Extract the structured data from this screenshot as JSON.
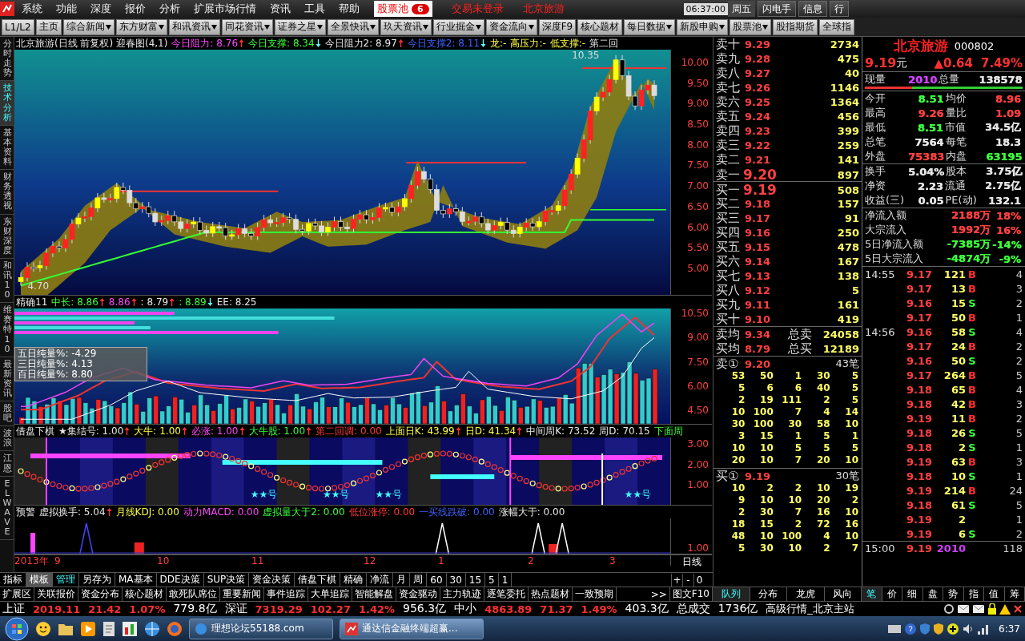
{
  "menu": {
    "items": [
      "系统",
      "功能",
      "深度",
      "报价",
      "分析",
      "扩展市场行情",
      "资讯",
      "工具",
      "帮助"
    ],
    "pool": {
      "label": "股票池",
      "count": "6"
    },
    "notices": [
      "交易未登录",
      "北京旅游"
    ],
    "time": "06:37:00",
    "weekday": "周五",
    "buttons": [
      "闪电手",
      "信息",
      "行"
    ]
  },
  "toolbar": [
    {
      "label": "L1/L2",
      "dropdown": false
    },
    {
      "label": "主页",
      "dropdown": false
    },
    {
      "label": "综合新闻",
      "dropdown": true
    },
    {
      "label": "东方财富",
      "dropdown": true
    },
    {
      "label": "和讯资讯",
      "dropdown": true
    },
    {
      "label": "同花资讯",
      "dropdown": true
    },
    {
      "label": "证券之星",
      "dropdown": true
    },
    {
      "label": "全景快讯",
      "dropdown": true
    },
    {
      "label": "玖天资讯",
      "dropdown": true
    },
    {
      "label": "行业掘金",
      "dropdown": true
    },
    {
      "label": "资金流向",
      "dropdown": true
    },
    {
      "label": "深度F9",
      "dropdown": false
    },
    {
      "label": "核心题材",
      "dropdown": false
    },
    {
      "label": "每日数据",
      "dropdown": true
    },
    {
      "label": "新股申购",
      "dropdown": true
    },
    {
      "label": "股票池",
      "dropdown": true
    },
    {
      "label": "股指期货",
      "dropdown": false
    },
    {
      "label": "全球指",
      "dropdown": false
    }
  ],
  "side_tabs": [
    {
      "label": "分时走势",
      "selected": false
    },
    {
      "label": "技术分析",
      "selected": true
    },
    {
      "label": "基本资料",
      "selected": false
    },
    {
      "label": "财务透视",
      "selected": false
    },
    {
      "label": "东财深度",
      "selected": false
    },
    {
      "label": "和讯10",
      "selected": false
    },
    {
      "label": "维赛特10",
      "selected": false
    },
    {
      "label": "最新资讯",
      "selected": false
    },
    {
      "label": "股吧",
      "selected": false
    },
    {
      "label": "波浪",
      "selected": false
    },
    {
      "label": "江恩",
      "selected": false
    },
    {
      "label": "ELWAVE",
      "selected": false
    }
  ],
  "panels": [
    {
      "kind": "price",
      "header": [
        {
          "text": "北京旅游(日线 前复权) 迎春图(4,1)",
          "kind": "white",
          "up": false,
          "down": false
        },
        {
          "text": "今日阻力: 8.76",
          "kind": "magenta",
          "up": true,
          "down": false
        },
        {
          "text": "今日支撑: 8.34",
          "kind": "green",
          "up": false,
          "down": true
        },
        {
          "text": "今日阻力2: 8.97",
          "kind": "white",
          "up": true,
          "down": false
        },
        {
          "text": "今日支撑2: 8.11",
          "kind": "blue",
          "up": false,
          "down": true
        },
        {
          "text": "龙:-",
          "kind": "yellow",
          "up": false,
          "down": false
        },
        {
          "text": "高压力:-",
          "kind": "yellow",
          "up": false,
          "down": false
        },
        {
          "text": "低支撑:-",
          "kind": "yellow",
          "up": false,
          "down": false
        },
        {
          "text": "第二回",
          "kind": "white",
          "up": false,
          "down": false
        }
      ],
      "yticks": [
        "10.00",
        "9.50",
        "9.00",
        "8.50",
        "8.00",
        "7.50",
        "7.00",
        "6.50",
        "6.00",
        "5.50",
        "5.00"
      ],
      "labels": [
        "10.35",
        "4.70"
      ]
    },
    {
      "kind": "volume",
      "header": [
        {
          "text": "精确11",
          "kind": "white",
          "up": false,
          "down": false
        },
        {
          "text": "中长: 8.86",
          "kind": "green",
          "up": true,
          "down": false
        },
        {
          "text": "8.86",
          "kind": "magenta",
          "up": true,
          "down": false
        },
        {
          "text": ": 8.79",
          "kind": "white",
          "up": true,
          "down": false
        },
        {
          "text": ": 8.89",
          "kind": "green",
          "up": false,
          "down": true
        },
        {
          "text": "EE: 8.25",
          "kind": "white",
          "up": false,
          "down": false
        }
      ],
      "yticks": [
        "10.50",
        "9.00",
        "7.50",
        "6.00",
        "4.50"
      ],
      "labels": [
        "五日纯量%: -4.29",
        "三日纯量%: 4.13",
        "百日纯量%: 8.80"
      ]
    },
    {
      "kind": "signal",
      "header": [
        {
          "text": "借盘下棋",
          "kind": "white",
          "up": false,
          "down": false
        },
        {
          "text": "★集结号: 1.00",
          "kind": "white",
          "up": true,
          "down": false
        },
        {
          "text": "大牛: 1.00",
          "kind": "yellow",
          "up": true,
          "down": false
        },
        {
          "text": "必涨: 1.00",
          "kind": "magenta",
          "up": true,
          "down": false
        },
        {
          "text": "大牛股: 1.00",
          "kind": "green",
          "up": true,
          "down": false
        },
        {
          "text": "第二回调: 0.00",
          "kind": "red",
          "up": false,
          "down": false
        },
        {
          "text": "上面日K: 43.99",
          "kind": "yellow",
          "up": true,
          "down": false
        },
        {
          "text": "日D: 41.34",
          "kind": "yellow",
          "up": true,
          "down": false
        },
        {
          "text": "中间周K: 73.52",
          "kind": "white",
          "up": false,
          "down": false
        },
        {
          "text": "周D: 70.15",
          "kind": "white",
          "up": false,
          "down": false
        },
        {
          "text": "下面周",
          "kind": "green",
          "up": false,
          "down": false
        }
      ],
      "yticks": [
        "3.00",
        "2.00",
        "1.00"
      ],
      "labels": [
        "★★号",
        "★★号",
        "★★号",
        "★★号"
      ]
    },
    {
      "kind": "alert",
      "header": [
        {
          "text": "预警",
          "kind": "white",
          "up": false,
          "down": false
        },
        {
          "text": "虚拟换手: 5.04",
          "kind": "white",
          "up": true,
          "down": false
        },
        {
          "text": "月线KDJ: 0.00",
          "kind": "yellow",
          "up": false,
          "down": false
        },
        {
          "text": "动力MACD: 0.00",
          "kind": "magenta",
          "up": false,
          "down": false
        },
        {
          "text": "虚拟量大于2: 0.00",
          "kind": "green",
          "up": false,
          "down": false
        },
        {
          "text": "低位涨停: 0.00",
          "kind": "red",
          "up": false,
          "down": false
        },
        {
          "text": "一买线跌破: 0.00",
          "kind": "blue",
          "up": false,
          "down": false
        },
        {
          "text": "涨幅大于: 0.00",
          "kind": "white",
          "up": false,
          "down": false
        }
      ],
      "yticks": [
        "1.00"
      ]
    }
  ],
  "xaxis": {
    "labels": [
      "2013年",
      "9",
      "10",
      "11",
      "12",
      "1",
      "2",
      "3"
    ],
    "period": "日线"
  },
  "tabs_row": {
    "items": [
      {
        "label": "指标",
        "selected": false,
        "accent": false
      },
      {
        "label": "模板",
        "selected": true,
        "accent": false
      },
      {
        "label": "管理",
        "selected": false,
        "accent": true
      },
      {
        "label": "另存为",
        "selected": false,
        "accent": false
      },
      {
        "label": "MA基本",
        "selected": false,
        "accent": false
      },
      {
        "label": "DDE决策",
        "selected": false,
        "accent": false
      },
      {
        "label": "SUP决策",
        "selected": false,
        "accent": false
      },
      {
        "label": "资金决策",
        "selected": false,
        "accent": false
      },
      {
        "label": "借盘下棋",
        "selected": false,
        "accent": false
      },
      {
        "label": "精确",
        "selected": false,
        "accent": false
      },
      {
        "label": "净流",
        "selected": false,
        "accent": false
      },
      {
        "label": "月",
        "selected": false,
        "accent": false
      },
      {
        "label": "周",
        "selected": false,
        "accent": false
      },
      {
        "label": "60",
        "selected": false,
        "accent": false
      },
      {
        "label": "30",
        "selected": false,
        "accent": false
      },
      {
        "label": "15",
        "selected": false,
        "accent": false
      },
      {
        "label": "5",
        "selected": false,
        "accent": false
      },
      {
        "label": "1",
        "selected": false,
        "accent": false
      }
    ],
    "zoom": [
      "+",
      "-",
      "0"
    ]
  },
  "ext_tabs": {
    "items": [
      "扩展区",
      "关联报价",
      "资金分布",
      "核心题材",
      "敢死队席位",
      "重要新闻",
      "事件追踪",
      "大单追踪",
      "智能解盘",
      "资金驱动",
      "主力轨迹",
      "逐笔委托",
      "热点题材",
      "一致预期"
    ],
    "more": ">>",
    "f10": "图文F10",
    "book_tabs": [
      {
        "label": "队列",
        "selected": true
      },
      {
        "label": "分布",
        "selected": false
      },
      {
        "label": "龙虎",
        "selected": false
      },
      {
        "label": "风向",
        "selected": false
      }
    ],
    "quote_tabs": [
      {
        "label": "笔",
        "selected": true
      },
      {
        "label": "价",
        "selected": false
      },
      {
        "label": "细",
        "selected": false
      },
      {
        "label": "盘",
        "selected": false
      },
      {
        "label": "势",
        "selected": false
      },
      {
        "label": "指",
        "selected": false
      },
      {
        "label": "值",
        "selected": false
      },
      {
        "label": "筹",
        "selected": false
      }
    ]
  },
  "order_book": {
    "asks": [
      {
        "label": "卖十",
        "price": "9.29",
        "volume": "2734",
        "best": false
      },
      {
        "label": "卖九",
        "price": "9.28",
        "volume": "475",
        "best": false
      },
      {
        "label": "卖八",
        "price": "9.27",
        "volume": "40",
        "best": false
      },
      {
        "label": "卖七",
        "price": "9.26",
        "volume": "1146",
        "best": false
      },
      {
        "label": "卖六",
        "price": "9.25",
        "volume": "1364",
        "best": false
      },
      {
        "label": "卖五",
        "price": "9.24",
        "volume": "456",
        "best": false
      },
      {
        "label": "卖四",
        "price": "9.23",
        "volume": "399",
        "best": false
      },
      {
        "label": "卖三",
        "price": "9.22",
        "volume": "259",
        "best": false
      },
      {
        "label": "卖二",
        "price": "9.21",
        "volume": "141",
        "best": false
      },
      {
        "label": "卖一",
        "price": "9.20",
        "volume": "897",
        "best": true
      }
    ],
    "bids": [
      {
        "label": "买一",
        "price": "9.19",
        "volume": "508",
        "best": true
      },
      {
        "label": "买二",
        "price": "9.18",
        "volume": "157",
        "best": false
      },
      {
        "label": "买三",
        "price": "9.17",
        "volume": "91",
        "best": false
      },
      {
        "label": "买四",
        "price": "9.16",
        "volume": "250",
        "best": false
      },
      {
        "label": "买五",
        "price": "9.15",
        "volume": "478",
        "best": false
      },
      {
        "label": "买六",
        "price": "9.14",
        "volume": "167",
        "best": false
      },
      {
        "label": "买七",
        "price": "9.13",
        "volume": "138",
        "best": false
      },
      {
        "label": "买八",
        "price": "9.12",
        "volume": "5",
        "best": false
      },
      {
        "label": "买九",
        "price": "9.11",
        "volume": "161",
        "best": false
      },
      {
        "label": "买十",
        "price": "9.10",
        "volume": "419",
        "best": false
      }
    ],
    "averages": [
      {
        "label": "卖均",
        "price": "9.34",
        "total_label": "总卖",
        "total": "24058"
      },
      {
        "label": "买均",
        "price": "8.79",
        "total_label": "总买",
        "total": "12189"
      }
    ],
    "queues": [
      {
        "label": "卖①",
        "price": "9.20",
        "count": "43笔",
        "rows": [
          [
            "53",
            "50",
            "1",
            "30",
            "5"
          ],
          [
            "5",
            "6",
            "6",
            "40",
            "5"
          ],
          [
            "2",
            "19",
            "111",
            "2",
            "5"
          ],
          [
            "10",
            "100",
            "7",
            "4",
            "14"
          ],
          [
            "30",
            "100",
            "30",
            "58",
            "10"
          ],
          [
            "3",
            "15",
            "1",
            "5",
            "1"
          ],
          [
            "10",
            "10",
            "5",
            "5",
            "5"
          ],
          [
            "20",
            "10",
            "7",
            "20",
            "10"
          ]
        ]
      },
      {
        "label": "买①",
        "price": "9.19",
        "count": "30笔",
        "rows": [
          [
            "10",
            "2",
            "2",
            "10",
            "19"
          ],
          [
            "9",
            "10",
            "10",
            "20",
            "2"
          ],
          [
            "2",
            "30",
            "7",
            "16",
            "10"
          ],
          [
            "18",
            "15",
            "2",
            "72",
            "16"
          ],
          [
            "48",
            "10",
            "100",
            "4",
            "10"
          ],
          [
            "5",
            "30",
            "10",
            "2",
            "7"
          ]
        ]
      }
    ]
  },
  "quote": {
    "name": "北京旅游",
    "code": "000802",
    "price": "9.19",
    "unit": "元",
    "change": "▲0.64",
    "pct": "7.49%",
    "current_label": "现量",
    "current": "2010",
    "total_label": "总量",
    "total": "138578",
    "level": 0.3,
    "stats": [
      {
        "label": "今开",
        "value": "8.51",
        "color": "#3cff3c"
      },
      {
        "label": "均价",
        "value": "8.96",
        "color": "#ff4040"
      },
      {
        "label": "最高",
        "value": "9.26",
        "color": "#ff4040"
      },
      {
        "label": "量比",
        "value": "1.09",
        "color": "#ff4040"
      },
      {
        "label": "最低",
        "value": "8.51",
        "color": "#3cff3c"
      },
      {
        "label": "市值",
        "value": "34.5亿",
        "color": "#e6e6e6"
      },
      {
        "label": "总笔",
        "value": "7564",
        "color": "#e6e6e6"
      },
      {
        "label": "每笔",
        "value": "18.3",
        "color": "#e6e6e6"
      },
      {
        "label": "外盘",
        "value": "75383",
        "color": "#ff4040"
      },
      {
        "label": "内盘",
        "value": "63195",
        "color": "#3cff3c"
      }
    ],
    "stats2": [
      {
        "label": "换手",
        "value": "5.04%"
      },
      {
        "label": "股本",
        "value": "3.75亿"
      },
      {
        "label": "净资",
        "value": "2.23"
      },
      {
        "label": "流通",
        "value": "2.75亿"
      },
      {
        "label": "收益(三)",
        "value": "0.05"
      },
      {
        "label": "PE(动)",
        "value": "132.1"
      }
    ],
    "flows": [
      {
        "label": "净流入额",
        "amount": "2188万",
        "pct": "18%",
        "color": "#ff4040"
      },
      {
        "label": "大宗流入",
        "amount": "1992万",
        "pct": "16%",
        "color": "#ff4040"
      },
      {
        "label": "5日净流入额",
        "amount": "-7385万",
        "pct": "-14%",
        "color": "#3cff3c"
      },
      {
        "label": "5日大宗流入",
        "amount": "-4874万",
        "pct": "-9%",
        "color": "#3cff3c"
      }
    ]
  },
  "ticks": [
    {
      "time": "14:55",
      "price": "9.17",
      "volume": "121",
      "side": "B",
      "count": "4",
      "kind": "buy"
    },
    {
      "price": "9.17",
      "volume": "13",
      "side": "B",
      "count": "3",
      "kind": "buy"
    },
    {
      "price": "9.16",
      "volume": "15",
      "side": "S",
      "count": "2",
      "kind": "sell"
    },
    {
      "price": "9.17",
      "volume": "50",
      "side": "B",
      "count": "1",
      "kind": "buy"
    },
    {
      "time": "14:56",
      "price": "9.16",
      "volume": "58",
      "side": "S",
      "count": "4",
      "kind": "sell"
    },
    {
      "price": "9.17",
      "volume": "24",
      "side": "B",
      "count": "2",
      "kind": "buy"
    },
    {
      "price": "9.16",
      "volume": "50",
      "side": "S",
      "count": "2",
      "kind": "sell"
    },
    {
      "price": "9.17",
      "volume": "264",
      "side": "B",
      "count": "5",
      "kind": "buy"
    },
    {
      "price": "9.18",
      "volume": "65",
      "side": "B",
      "count": "4",
      "kind": "buy"
    },
    {
      "price": "9.18",
      "volume": "42",
      "side": "B",
      "count": "3",
      "kind": "buy"
    },
    {
      "price": "9.19",
      "volume": "11",
      "side": "B",
      "count": "2",
      "kind": "buy"
    },
    {
      "price": "9.18",
      "volume": "26",
      "side": "S",
      "count": "5",
      "kind": "sell"
    },
    {
      "price": "9.18",
      "volume": "2",
      "side": "S",
      "count": "1",
      "kind": "sell"
    },
    {
      "price": "9.19",
      "volume": "63",
      "side": "B",
      "count": "3",
      "kind": "buy"
    },
    {
      "price": "9.18",
      "volume": "10",
      "side": "S",
      "count": "1",
      "kind": "sell"
    },
    {
      "price": "9.19",
      "volume": "214",
      "side": "B",
      "count": "24",
      "kind": "buy"
    },
    {
      "price": "9.18",
      "volume": "61",
      "side": "S",
      "count": "5",
      "kind": "sell"
    },
    {
      "price": "9.19",
      "volume": "2",
      "count": "1",
      "kind": "neutral"
    },
    {
      "price": "9.19",
      "volume": "6",
      "side": "S",
      "count": "2",
      "kind": "sell"
    },
    {
      "time": "15:00",
      "price": "9.19",
      "volume": "2010",
      "count": "118",
      "kind": "summary"
    }
  ],
  "status": {
    "indices": [
      {
        "name": "上证",
        "value": "2019.11",
        "change": "21.42",
        "pct": "1.07%",
        "amount": "779.8亿"
      },
      {
        "name": "深证",
        "value": "7319.29",
        "change": "102.27",
        "pct": "1.42%",
        "amount": "956.3亿"
      },
      {
        "name": "中小",
        "value": "4863.89",
        "change": "71.37",
        "pct": "1.49%",
        "amount": "403.3亿"
      }
    ],
    "total_label": "总成交",
    "total": "1736亿",
    "server": "高级行情_北京主站"
  },
  "taskbar": {
    "tasks": [
      {
        "label": "理想论坛55188.com",
        "selected": false
      },
      {
        "label": "通达信金融终端超赢...",
        "selected": true
      }
    ],
    "clock": "6:37"
  }
}
